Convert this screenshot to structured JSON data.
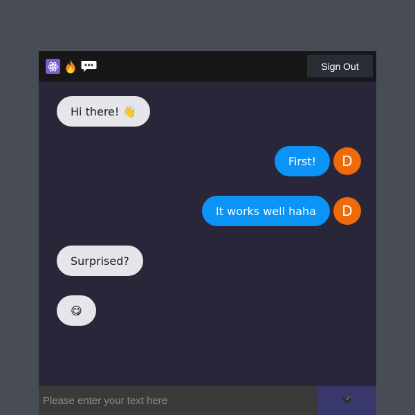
{
  "header": {
    "icons": [
      "atom-icon",
      "fire-icon",
      "speech-bubble-icon"
    ],
    "signout_label": "Sign Out"
  },
  "messages": [
    {
      "type": "received",
      "text": "Hi there! 👋"
    },
    {
      "type": "sent",
      "text": "First!",
      "avatar": "D"
    },
    {
      "type": "sent",
      "text": "It works well haha",
      "avatar": "D"
    },
    {
      "type": "received",
      "text": "Surprised?"
    },
    {
      "type": "received",
      "text": "😋"
    }
  ],
  "composer": {
    "placeholder": "Please enter your text here",
    "value": "",
    "send_icon": "dove-icon"
  },
  "colors": {
    "page_bg": "#474c55",
    "chat_bg": "#282638",
    "header_bg": "#181717",
    "sent_bubble": "#0b93f6",
    "received_bubble": "#e5e5ea",
    "avatar_bg": "#ee6b0b",
    "send_button_bg": "#38386b"
  }
}
